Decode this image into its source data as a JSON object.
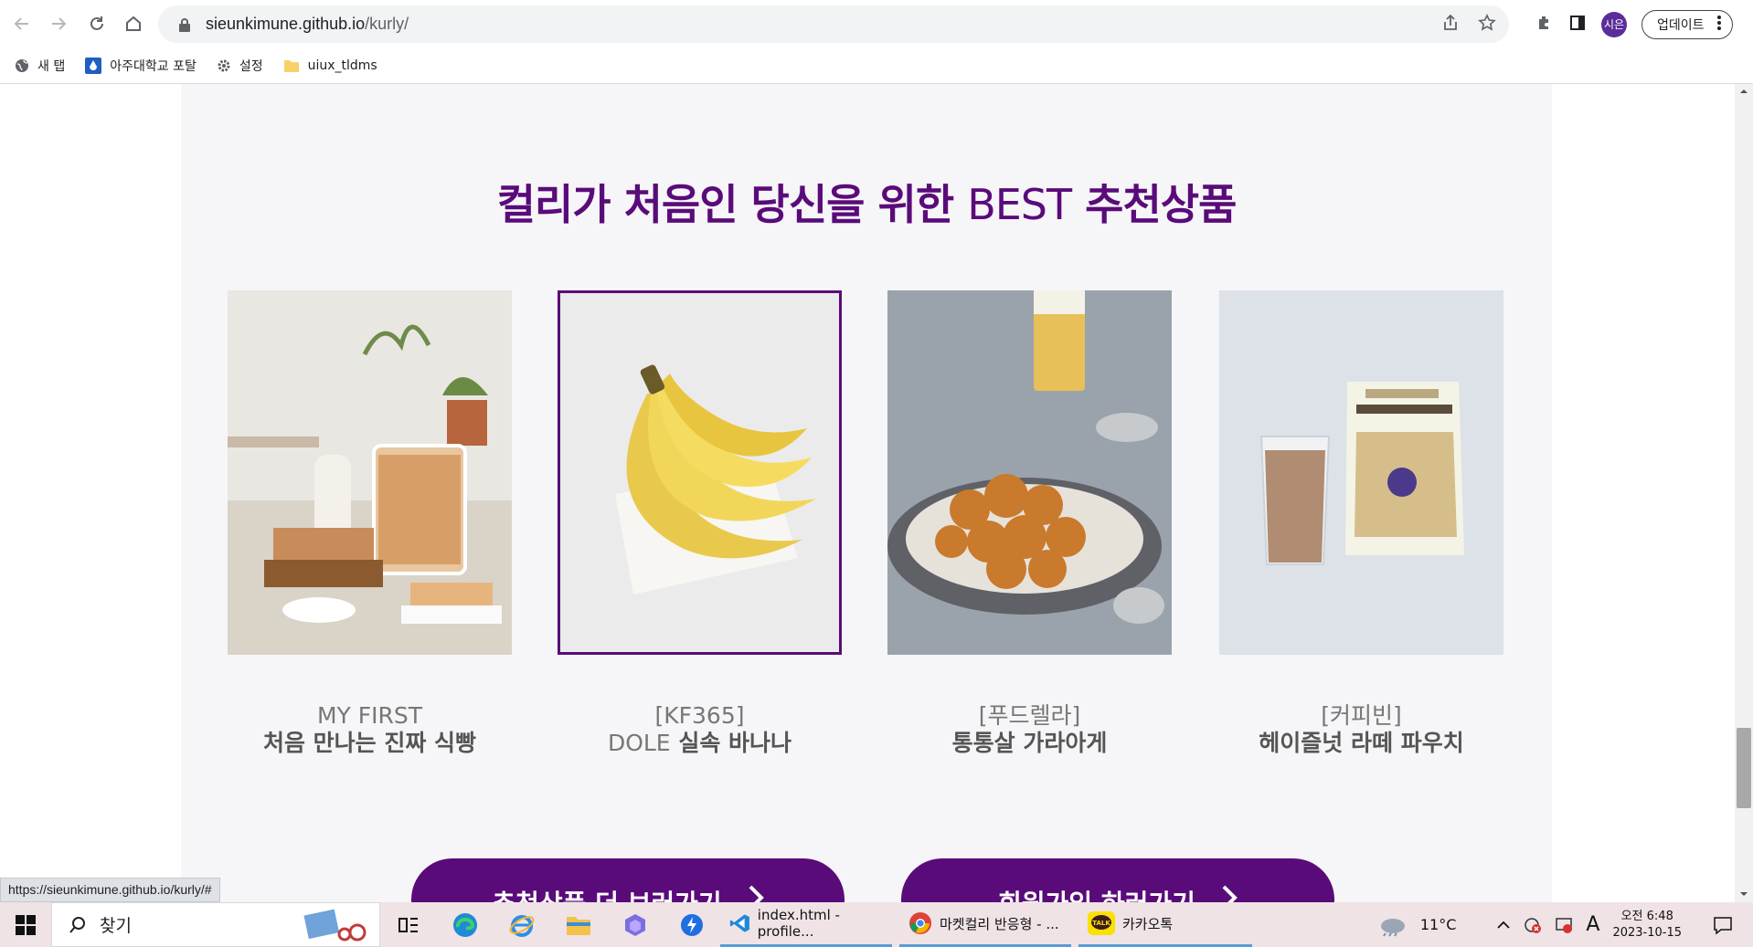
{
  "browser": {
    "url_host": "sieunkimune.github.io",
    "url_path": "/kurly/",
    "avatar_text": "시은",
    "update_label": "업데이트",
    "bookmarks": [
      {
        "label": "새 탭",
        "icon": "globe-icon"
      },
      {
        "label": "아주대학교 포탈",
        "icon": "ajou-icon"
      },
      {
        "label": "설정",
        "icon": "gear-icon"
      },
      {
        "label": "uiux_tldms",
        "icon": "folder-icon"
      }
    ],
    "status_url": "https://sieunkimune.github.io/kurly/#"
  },
  "page": {
    "title_part1": "컬리가 처음인 당신을 위한 ",
    "title_en": "BEST",
    "title_part2": " 추천상품",
    "products": [
      {
        "brand": "MY FIRST",
        "name": "처음 만나는 진짜 식빵"
      },
      {
        "brand": "[KF365]",
        "name_prefix": "DOLE",
        "name": "실속 바나나"
      },
      {
        "brand": "[푸드렐라]",
        "name": "통통살 가라아게"
      },
      {
        "brand": "[커피빈]",
        "name": "헤이즐넛 라떼 파우치"
      }
    ],
    "cta_buttons": [
      {
        "label": "추천상품 더 보러가기"
      },
      {
        "label": "회원가입 하러가기"
      }
    ],
    "accent_color": "#5a0b7a"
  },
  "taskbar": {
    "search_placeholder": "찾기",
    "apps": [
      {
        "label": "index.html - profile..."
      },
      {
        "label": "마켓컬리 반응형 - ..."
      },
      {
        "label": "카카오톡"
      }
    ],
    "weather": "11°C",
    "ime": "A",
    "time": "오전 6:48",
    "date": "2023-10-15"
  }
}
